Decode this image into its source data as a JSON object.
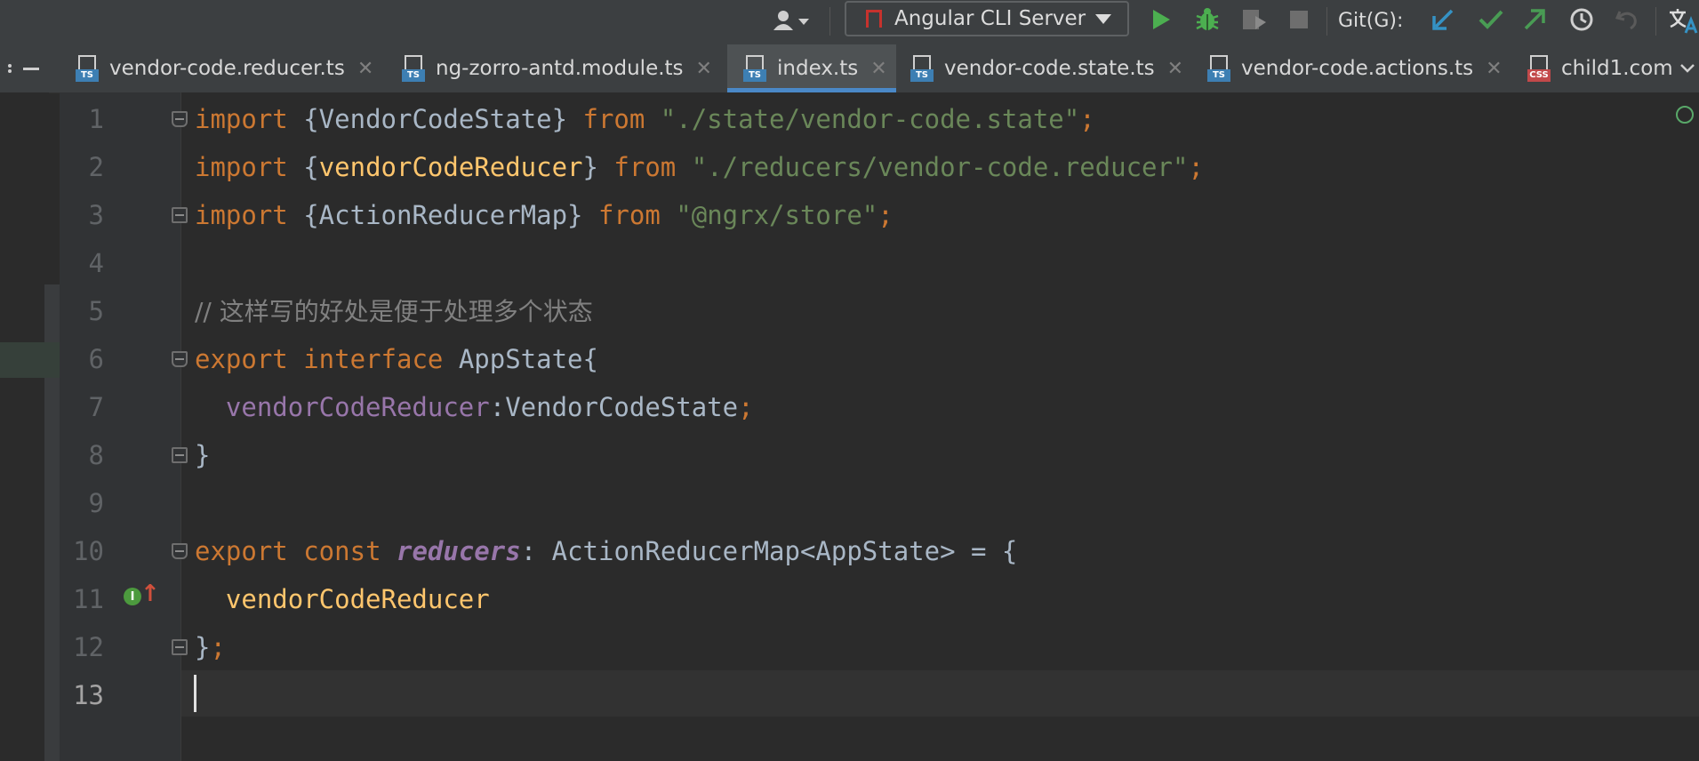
{
  "toolbar": {
    "run_config_label": "Angular CLI Server",
    "git_label": "Git(G):"
  },
  "tabs": [
    {
      "name": "vendor-code.reducer.ts",
      "badge": "TS",
      "active": false
    },
    {
      "name": "ng-zorro-antd.module.ts",
      "badge": "TS",
      "active": false
    },
    {
      "name": "index.ts",
      "badge": "TS",
      "active": true
    },
    {
      "name": "vendor-code.state.ts",
      "badge": "TS",
      "active": false
    },
    {
      "name": "vendor-code.actions.ts",
      "badge": "TS",
      "active": false
    },
    {
      "name": "child1.com",
      "badge": "CSS",
      "active": false
    }
  ],
  "colors": {
    "ts_badge": "#3d7fb3",
    "css_badge": "#c2494a",
    "run_green": "#4caf50",
    "git_blue": "#3592c4",
    "git_green": "#499c54"
  },
  "editor": {
    "current_line": 13,
    "lines": [
      {
        "n": "1"
      },
      {
        "n": "2"
      },
      {
        "n": "3"
      },
      {
        "n": "4"
      },
      {
        "n": "5"
      },
      {
        "n": "6"
      },
      {
        "n": "7"
      },
      {
        "n": "8"
      },
      {
        "n": "9"
      },
      {
        "n": "10"
      },
      {
        "n": "11"
      },
      {
        "n": "12"
      },
      {
        "n": "13"
      }
    ],
    "code": {
      "l1": {
        "kw": "import",
        "a": " {VendorCodeState} ",
        "from": "from",
        "s": " \"./state/vendor-code.state\"",
        "semi": ";"
      },
      "l2": {
        "kw": "import",
        "a": " {",
        "name": "vendorCodeReducer",
        "b": "} ",
        "from": "from",
        "s": " \"./reducers/vendor-code.reducer\"",
        "semi": ";"
      },
      "l3": {
        "kw": "import",
        "a": " {ActionReducerMap} ",
        "from": "from",
        "s": " \"@ngrx/store\"",
        "semi": ";"
      },
      "l5": {
        "comment": "// 这样写的好处是便于处理多个状态"
      },
      "l6": {
        "kw1": "export",
        "kw2": " interface",
        "rest": " AppState{"
      },
      "l7": {
        "field": "  vendorCodeReducer",
        "rest": ":VendorCodeState",
        "semi": ";"
      },
      "l8": {
        "rest": "}"
      },
      "l10": {
        "kw1": "export",
        "kw2": " const",
        "sp": " ",
        "name": "reducers",
        "rest": ": ActionReducerMap<AppState> = {"
      },
      "l11": {
        "name": "  vendorCodeReducer"
      },
      "l12": {
        "rest": "}",
        "semi": ";"
      }
    }
  }
}
